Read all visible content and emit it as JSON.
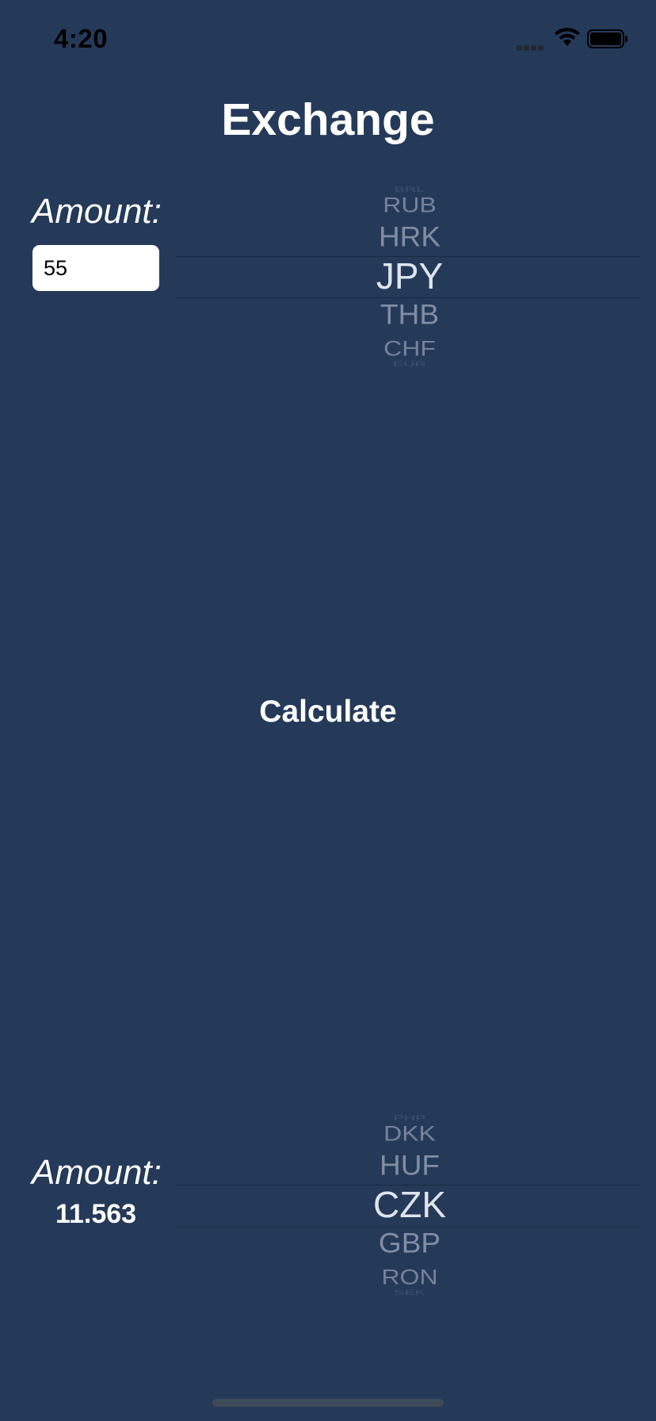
{
  "status_bar": {
    "time": "4:20",
    "icons": [
      "cellular-signal-icon",
      "wifi-icon",
      "battery-icon"
    ]
  },
  "title": "Exchange",
  "from": {
    "label": "Amount:",
    "input_value": "55",
    "picker": {
      "items": [
        "BRL",
        "RUB",
        "HRK",
        "JPY",
        "THB",
        "CHF",
        "EUR"
      ],
      "selected": "JPY"
    }
  },
  "calculate_label": "Calculate",
  "to": {
    "label": "Amount:",
    "result_value": "11.563",
    "picker": {
      "items": [
        "PHP",
        "DKK",
        "HUF",
        "CZK",
        "GBP",
        "RON",
        "SEK"
      ],
      "selected": "CZK"
    }
  },
  "colors": {
    "background": "#253a59",
    "text": "#ffffff",
    "picker_unselected": "#8a95a8",
    "picker_selected": "#dfe4ec"
  }
}
